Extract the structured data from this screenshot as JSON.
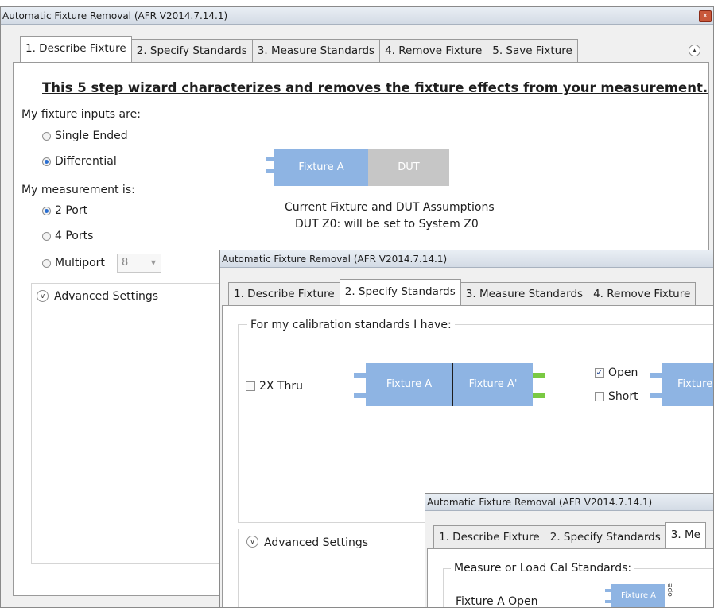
{
  "window1": {
    "title": "Automatic Fixture Removal (AFR V2014.7.14.1)",
    "close_glyph": "x",
    "tabs": [
      "1. Describe Fixture",
      "2. Specify Standards",
      "3. Measure Standards",
      "4. Remove Fixture",
      "5. Save Fixture"
    ],
    "active_tab": "1. Describe Fixture",
    "collapse_glyph": "^",
    "heading": "This 5 step wizard characterizes and removes the fixture effects from your measurement.",
    "inputs_label": "My fixture inputs are:",
    "inputs_options": [
      "Single Ended",
      "Differential"
    ],
    "inputs_selected": "Differential",
    "measurement_label": "My measurement is:",
    "measurement_options": [
      "2 Port",
      "4 Ports",
      "Multiport"
    ],
    "measurement_selected": "2 Port",
    "multiport_value": "8",
    "diagram": {
      "fixture": "Fixture A",
      "dut": "DUT"
    },
    "assumptions_line1": "Current Fixture and DUT Assumptions",
    "assumptions_line2": "DUT Z0: will be set to System Z0",
    "advanced_settings": "Advanced Settings",
    "chevron_glyph": "v"
  },
  "window2": {
    "title": "Automatic Fixture Removal (AFR V2014.7.14.1)",
    "tabs": [
      "1. Describe Fixture",
      "2. Specify Standards",
      "3. Measure Standards",
      "4. Remove Fixture"
    ],
    "active_tab": "2. Specify Standards",
    "group_label": "For my calibration standards I have:",
    "thru_label": "2X Thru",
    "thru_checked": false,
    "thru_fixture_a": "Fixture A",
    "thru_fixture_a_prime": "Fixture A'",
    "open_label": "Open",
    "open_checked": true,
    "short_label": "Short",
    "short_checked": false,
    "open_fixture": "Fixture",
    "check_glyph": "✓",
    "advanced_settings": "Advanced Settings",
    "chevron_glyph": "v"
  },
  "window3": {
    "title": "Automatic Fixture Removal (AFR V2014.7.14.1)",
    "tabs": [
      "1. Describe Fixture",
      "2. Specify Standards",
      "3. Me"
    ],
    "active_tab": "3. Me",
    "group_label": "Measure or Load Cal Standards:",
    "row1_label": "Fixture A Open",
    "row1_fixture": "Fixture A",
    "row1_side_text": "ope"
  },
  "colors": {
    "fixture_blue": "#8eb4e3",
    "dut_gray": "#c6c6c6",
    "connector_green": "#7ac943",
    "radio_selected": "#2b6fd1"
  }
}
